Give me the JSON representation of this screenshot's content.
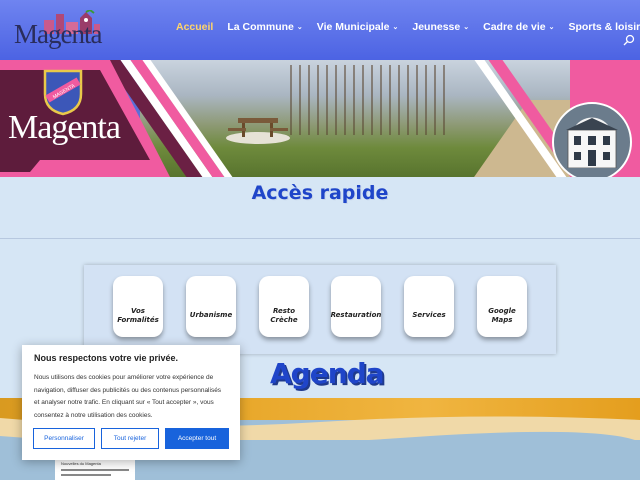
{
  "header": {
    "logo_text": "Magenta",
    "nav": [
      {
        "label": "Accueil",
        "dropdown": false,
        "active": true
      },
      {
        "label": "La Commune",
        "dropdown": true
      },
      {
        "label": "Vie Municipale",
        "dropdown": true
      },
      {
        "label": "Jeunesse",
        "dropdown": true
      },
      {
        "label": "Cadre de vie",
        "dropdown": true
      },
      {
        "label": "Sports & loisirs",
        "dropdown": true
      }
    ],
    "search_icon": "search-icon"
  },
  "banner": {
    "crest_text": "Magenta",
    "shield_label": "MAGENTA"
  },
  "acces_rapide": {
    "title": "Accès rapide",
    "tiles": [
      {
        "label": "Vos Formalités"
      },
      {
        "label": "Urbanisme"
      },
      {
        "label": "Resto Crèche"
      },
      {
        "label": "Restauration"
      },
      {
        "label": "Services"
      },
      {
        "label": "Google Maps"
      }
    ]
  },
  "agenda": {
    "title": "Agenda",
    "poster_heading": "Nouvelles du Magenta"
  },
  "cookie": {
    "title": "Nous respectons votre vie privée.",
    "text": "Nous utilisons des cookies pour améliorer votre expérience de navigation, diffuser des publicités ou des contenus personnalisés et analyser notre trafic. En cliquant sur « Tout accepter », vous consentez à notre utilisation des cookies.",
    "btn_customize": "Personnaliser",
    "btn_reject": "Tout rejeter",
    "btn_accept": "Accepter tout"
  },
  "colors": {
    "header_blue": "#4c63e3",
    "active_nav": "#ffd56a",
    "title_blue": "#1f45c9",
    "magenta": "#f05ba0",
    "cookie_button": "#1863dc"
  }
}
